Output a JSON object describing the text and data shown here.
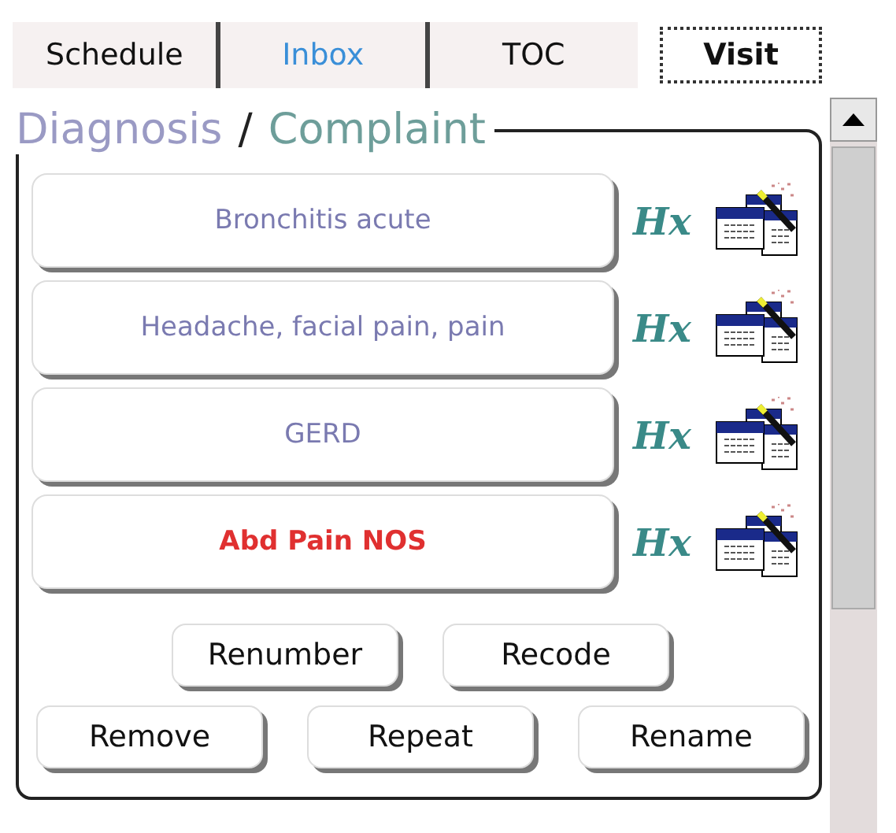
{
  "tabs": [
    {
      "label": "Schedule",
      "selected": false,
      "color": "#111111"
    },
    {
      "label": "Inbox",
      "selected": false,
      "color": "#3a8fd8"
    },
    {
      "label": "TOC",
      "selected": false,
      "color": "#111111"
    },
    {
      "label": "Visit",
      "selected": true,
      "color": "#111111"
    }
  ],
  "panel": {
    "legend": [
      {
        "text": "Diagnosis",
        "color": "#9a9ac4"
      },
      {
        "text": "/",
        "color": "#222222"
      },
      {
        "text": "Complaint",
        "color": "#6e9e9a"
      }
    ],
    "diagnoses": [
      {
        "label": "Bronchitis acute",
        "selected": false,
        "history": "Hx"
      },
      {
        "label": "Headache, facial pain, pain",
        "selected": false,
        "history": "Hx"
      },
      {
        "label": "GERD",
        "selected": false,
        "history": "Hx"
      },
      {
        "label": "Abd Pain NOS",
        "selected": true,
        "history": "Hx"
      }
    ],
    "button_rows": [
      [
        "Renumber",
        "Recode"
      ],
      [
        "Remove",
        "Repeat",
        "Rename"
      ]
    ]
  }
}
